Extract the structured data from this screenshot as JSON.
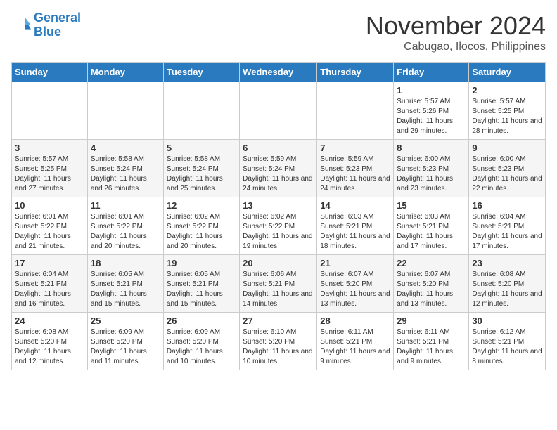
{
  "header": {
    "logo_line1": "General",
    "logo_line2": "Blue",
    "month": "November 2024",
    "location": "Cabugao, Ilocos, Philippines"
  },
  "weekdays": [
    "Sunday",
    "Monday",
    "Tuesday",
    "Wednesday",
    "Thursday",
    "Friday",
    "Saturday"
  ],
  "weeks": [
    [
      {
        "day": "",
        "info": ""
      },
      {
        "day": "",
        "info": ""
      },
      {
        "day": "",
        "info": ""
      },
      {
        "day": "",
        "info": ""
      },
      {
        "day": "",
        "info": ""
      },
      {
        "day": "1",
        "info": "Sunrise: 5:57 AM\nSunset: 5:26 PM\nDaylight: 11 hours and 29 minutes."
      },
      {
        "day": "2",
        "info": "Sunrise: 5:57 AM\nSunset: 5:25 PM\nDaylight: 11 hours and 28 minutes."
      }
    ],
    [
      {
        "day": "3",
        "info": "Sunrise: 5:57 AM\nSunset: 5:25 PM\nDaylight: 11 hours and 27 minutes."
      },
      {
        "day": "4",
        "info": "Sunrise: 5:58 AM\nSunset: 5:24 PM\nDaylight: 11 hours and 26 minutes."
      },
      {
        "day": "5",
        "info": "Sunrise: 5:58 AM\nSunset: 5:24 PM\nDaylight: 11 hours and 25 minutes."
      },
      {
        "day": "6",
        "info": "Sunrise: 5:59 AM\nSunset: 5:24 PM\nDaylight: 11 hours and 24 minutes."
      },
      {
        "day": "7",
        "info": "Sunrise: 5:59 AM\nSunset: 5:23 PM\nDaylight: 11 hours and 24 minutes."
      },
      {
        "day": "8",
        "info": "Sunrise: 6:00 AM\nSunset: 5:23 PM\nDaylight: 11 hours and 23 minutes."
      },
      {
        "day": "9",
        "info": "Sunrise: 6:00 AM\nSunset: 5:23 PM\nDaylight: 11 hours and 22 minutes."
      }
    ],
    [
      {
        "day": "10",
        "info": "Sunrise: 6:01 AM\nSunset: 5:22 PM\nDaylight: 11 hours and 21 minutes."
      },
      {
        "day": "11",
        "info": "Sunrise: 6:01 AM\nSunset: 5:22 PM\nDaylight: 11 hours and 20 minutes."
      },
      {
        "day": "12",
        "info": "Sunrise: 6:02 AM\nSunset: 5:22 PM\nDaylight: 11 hours and 20 minutes."
      },
      {
        "day": "13",
        "info": "Sunrise: 6:02 AM\nSunset: 5:22 PM\nDaylight: 11 hours and 19 minutes."
      },
      {
        "day": "14",
        "info": "Sunrise: 6:03 AM\nSunset: 5:21 PM\nDaylight: 11 hours and 18 minutes."
      },
      {
        "day": "15",
        "info": "Sunrise: 6:03 AM\nSunset: 5:21 PM\nDaylight: 11 hours and 17 minutes."
      },
      {
        "day": "16",
        "info": "Sunrise: 6:04 AM\nSunset: 5:21 PM\nDaylight: 11 hours and 17 minutes."
      }
    ],
    [
      {
        "day": "17",
        "info": "Sunrise: 6:04 AM\nSunset: 5:21 PM\nDaylight: 11 hours and 16 minutes."
      },
      {
        "day": "18",
        "info": "Sunrise: 6:05 AM\nSunset: 5:21 PM\nDaylight: 11 hours and 15 minutes."
      },
      {
        "day": "19",
        "info": "Sunrise: 6:05 AM\nSunset: 5:21 PM\nDaylight: 11 hours and 15 minutes."
      },
      {
        "day": "20",
        "info": "Sunrise: 6:06 AM\nSunset: 5:21 PM\nDaylight: 11 hours and 14 minutes."
      },
      {
        "day": "21",
        "info": "Sunrise: 6:07 AM\nSunset: 5:20 PM\nDaylight: 11 hours and 13 minutes."
      },
      {
        "day": "22",
        "info": "Sunrise: 6:07 AM\nSunset: 5:20 PM\nDaylight: 11 hours and 13 minutes."
      },
      {
        "day": "23",
        "info": "Sunrise: 6:08 AM\nSunset: 5:20 PM\nDaylight: 11 hours and 12 minutes."
      }
    ],
    [
      {
        "day": "24",
        "info": "Sunrise: 6:08 AM\nSunset: 5:20 PM\nDaylight: 11 hours and 12 minutes."
      },
      {
        "day": "25",
        "info": "Sunrise: 6:09 AM\nSunset: 5:20 PM\nDaylight: 11 hours and 11 minutes."
      },
      {
        "day": "26",
        "info": "Sunrise: 6:09 AM\nSunset: 5:20 PM\nDaylight: 11 hours and 10 minutes."
      },
      {
        "day": "27",
        "info": "Sunrise: 6:10 AM\nSunset: 5:20 PM\nDaylight: 11 hours and 10 minutes."
      },
      {
        "day": "28",
        "info": "Sunrise: 6:11 AM\nSunset: 5:21 PM\nDaylight: 11 hours and 9 minutes."
      },
      {
        "day": "29",
        "info": "Sunrise: 6:11 AM\nSunset: 5:21 PM\nDaylight: 11 hours and 9 minutes."
      },
      {
        "day": "30",
        "info": "Sunrise: 6:12 AM\nSunset: 5:21 PM\nDaylight: 11 hours and 8 minutes."
      }
    ]
  ]
}
